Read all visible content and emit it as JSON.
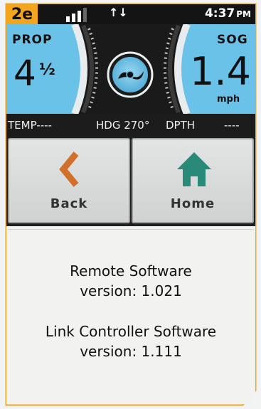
{
  "status_bar": {
    "page_badge": "2e",
    "time": "4:37",
    "ampm": "PM",
    "signal_bars_active": 3,
    "signal_bars_total": 4,
    "transfer_icon": "up-down-arrows-icon"
  },
  "gauges": {
    "prop": {
      "label": "PROP",
      "value": "4",
      "fraction": "½"
    },
    "sog": {
      "label": "SOG",
      "value": "1.4",
      "unit": "mph"
    },
    "center_icon": "propeller-icon"
  },
  "info_bar": {
    "temp": "TEMP----",
    "heading": "HDG 270°",
    "depth": "DPTH",
    "depth_value": "----"
  },
  "buttons": {
    "back": {
      "label": "Back",
      "icon": "chevron-left-icon",
      "color": "#d0702a"
    },
    "home": {
      "label": "Home",
      "icon": "home-icon",
      "color": "#2a8a7a"
    }
  },
  "content": {
    "remote_title": "Remote Software",
    "remote_version": "version: 1.021",
    "link_title": "Link Controller Software",
    "link_version": "version: 1.111"
  },
  "colors": {
    "accent": "#f3a51c",
    "gauge_blue": "#6bc2e8",
    "dark": "#141414"
  }
}
